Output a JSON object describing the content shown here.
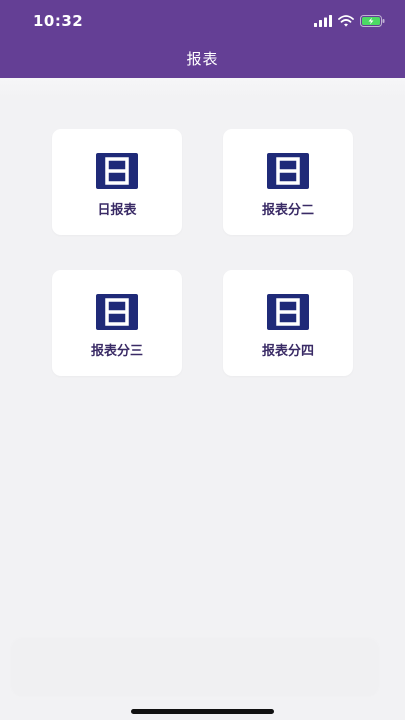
{
  "status_bar": {
    "time": "10:32"
  },
  "header": {
    "title": "报表"
  },
  "tiles": [
    {
      "label": "日报表",
      "icon": "calendar-day-icon"
    },
    {
      "label": "报表分二",
      "icon": "calendar-day-icon"
    },
    {
      "label": "报表分三",
      "icon": "calendar-day-icon"
    },
    {
      "label": "报表分四",
      "icon": "calendar-day-icon"
    }
  ],
  "colors": {
    "header_bg": "#643f95",
    "icon_navy": "#1f2a78",
    "label_text": "#3a2b66",
    "page_bg": "#f2f2f4",
    "battery_green": "#4cd964"
  }
}
